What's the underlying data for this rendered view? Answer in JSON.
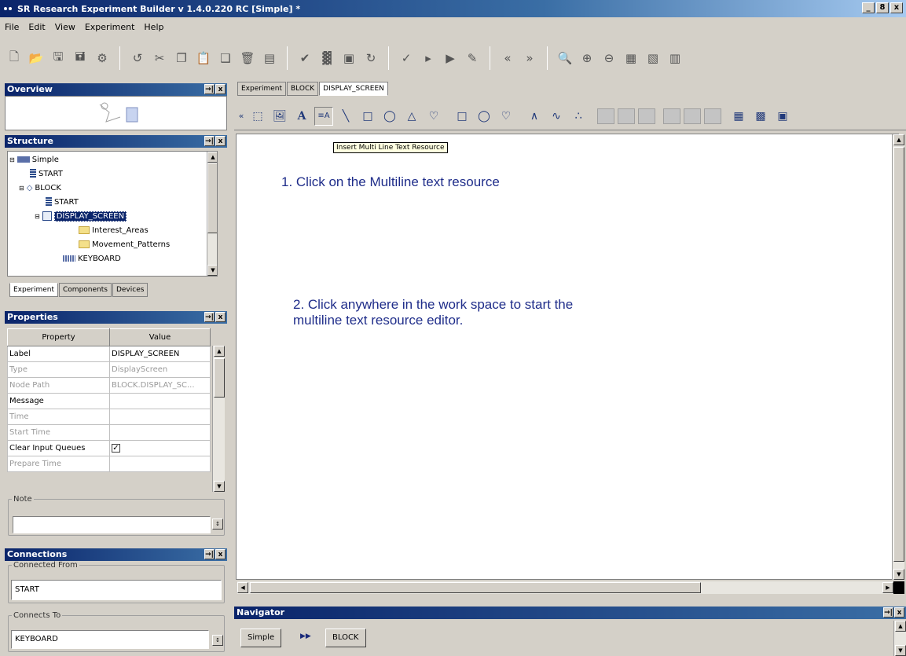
{
  "window": {
    "title": "SR Research Experiment Builder v 1.4.0.220 RC  [Simple] *",
    "controls": [
      "_",
      "8",
      "x"
    ]
  },
  "menu": [
    "File",
    "Edit",
    "View",
    "Experiment",
    "Help"
  ],
  "panels": {
    "overview": "Overview",
    "structure": "Structure",
    "properties": "Properties",
    "connections": "Connections",
    "panel_controls": [
      "→|",
      "x"
    ]
  },
  "tree": [
    {
      "label": "Simple",
      "icon": "experiment-icon"
    },
    {
      "label": "START",
      "icon": "start-icon"
    },
    {
      "label": "BLOCK",
      "icon": "sequence-icon"
    },
    {
      "label": "START",
      "icon": "start-icon"
    },
    {
      "label": "DISPLAY_SCREEN",
      "icon": "display-screen-icon",
      "selected": true
    },
    {
      "label": "Interest_Areas",
      "icon": "folder-icon"
    },
    {
      "label": "Movement_Patterns",
      "icon": "folder-icon"
    },
    {
      "label": "KEYBOARD",
      "icon": "keyboard-icon"
    }
  ],
  "structure_tabs": [
    "Experiment",
    "Components",
    "Devices"
  ],
  "properties": {
    "headers": [
      "Property",
      "Value"
    ],
    "rows": [
      {
        "property": "Label",
        "value": "DISPLAY_SCREEN",
        "dim": false
      },
      {
        "property": "Type",
        "value": "DisplayScreen",
        "dim": true
      },
      {
        "property": "Node Path",
        "value": "BLOCK.DISPLAY_SC...",
        "dim": true
      },
      {
        "property": "Message",
        "value": "",
        "dim": false
      },
      {
        "property": "Time",
        "value": "",
        "dim": true
      },
      {
        "property": "Start Time",
        "value": "",
        "dim": true
      },
      {
        "property": "Clear Input Queues",
        "value": "✓",
        "dim": false
      },
      {
        "property": "Prepare Time",
        "value": "",
        "dim": true
      }
    ]
  },
  "note": {
    "label": "Note",
    "value": ""
  },
  "connections": {
    "from_label": "Connected From",
    "from_value": "START",
    "to_label": "Connects To",
    "to_value": "KEYBOARD"
  },
  "editor_tabs": [
    "Experiment",
    "BLOCK",
    "DISPLAY_SCREEN"
  ],
  "tooltip": "Insert Multi Line Text Resource",
  "instructions": {
    "step1": "1. Click on the Multiline text resource",
    "step2_line1": "2. Click anywhere in the work space to start the",
    "step2_line2": "multiline text resource editor."
  },
  "navigator": {
    "title": "Navigator",
    "crumbs": [
      "Simple",
      "BLOCK"
    ],
    "separator": "▶▶"
  }
}
